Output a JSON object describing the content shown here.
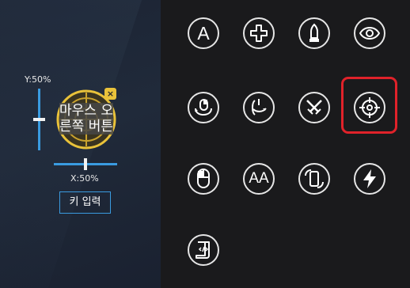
{
  "left_panel": {
    "y_label": "Y:50%",
    "x_label": "X:50%",
    "y_value_percent": 50,
    "x_value_percent": 50,
    "target_label": [
      "마우스 오",
      "른쪽 버튼"
    ],
    "close_symbol": "×",
    "key_input_label": "키 입력"
  },
  "toolbox": {
    "items": [
      {
        "name": "text-key",
        "text": "A"
      },
      {
        "name": "dpad",
        "icon": "dpad-icon"
      },
      {
        "name": "skill",
        "icon": "bullet-icon"
      },
      {
        "name": "view",
        "icon": "eye-icon"
      },
      {
        "name": "rotate-view",
        "icon": "mouse-rotate-icon"
      },
      {
        "name": "free-look",
        "icon": "rotate-axis-icon"
      },
      {
        "name": "attack",
        "icon": "crossed-swords-icon"
      },
      {
        "name": "aim",
        "icon": "crosshair-icon"
      },
      {
        "name": "mouse-click",
        "icon": "mouse-icon"
      },
      {
        "name": "multi-key",
        "text": "AA"
      },
      {
        "name": "rotate-device",
        "icon": "device-rotate-icon"
      },
      {
        "name": "quick-action",
        "icon": "lightning-icon"
      },
      {
        "name": "script",
        "icon": "script-icon"
      }
    ],
    "selected": "aim"
  },
  "colors": {
    "accent": "#3a9be0",
    "highlight": "#e0222a",
    "target_gold": "#e9c23a"
  }
}
